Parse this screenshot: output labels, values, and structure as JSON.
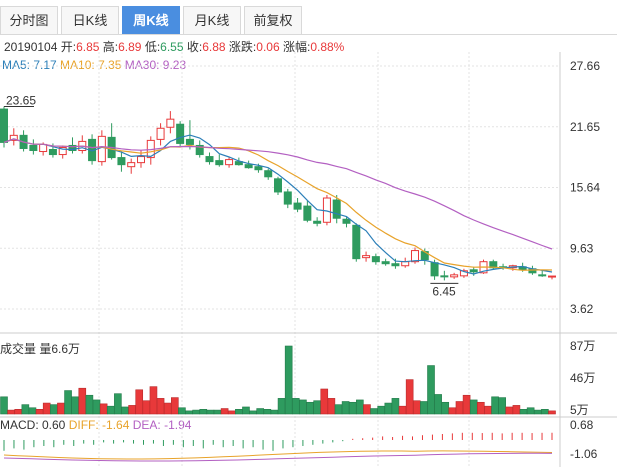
{
  "tabs": [
    {
      "label": "分时图",
      "active": false
    },
    {
      "label": "日K线",
      "active": false
    },
    {
      "label": "周K线",
      "active": true
    },
    {
      "label": "月K线",
      "active": false
    },
    {
      "label": "前复权",
      "active": false
    }
  ],
  "info": {
    "date": "20190104",
    "open_label": "开:",
    "open": "6.85",
    "high_label": "高:",
    "high": "6.89",
    "low_label": "低:",
    "low": "6.55",
    "close_label": "收:",
    "close": "6.88",
    "change_label": "涨跌:",
    "change": "0.06",
    "pct_label": "涨幅:",
    "pct": "0.88%"
  },
  "ma_legend": {
    "ma5": "MA5: 7.17",
    "ma10": "MA10: 7.35",
    "ma30": "MA30: 9.23"
  },
  "volume_legend": {
    "label": "成交量 量6.6万"
  },
  "macd_legend": {
    "macd": "MACD: 0.60",
    "diff": "DIFF: -1.64",
    "dea": "DEA: -1.94"
  },
  "colors": {
    "up": "#e8393a",
    "down": "#2e9b5f",
    "ma5": "#2c7fb8",
    "ma10": "#e8a32b",
    "ma30": "#b360c2",
    "grid": "#e3e3e3"
  },
  "chart_data": {
    "type": "candlestick",
    "price_axis": {
      "ticks": [
        "27.66",
        "21.65",
        "15.64",
        "9.63",
        "3.62"
      ],
      "ylim": [
        3.62,
        27.66
      ]
    },
    "annotations": {
      "max": "23.65",
      "min": "6.45"
    },
    "candles": [
      [
        23.4,
        23.65,
        19.6,
        20.1
      ],
      [
        20.3,
        21.5,
        19.8,
        20.8
      ],
      [
        20.8,
        21.3,
        19.2,
        19.5
      ],
      [
        19.8,
        20.4,
        18.9,
        19.3
      ],
      [
        19.2,
        20.1,
        18.8,
        19.9
      ],
      [
        19.4,
        20.0,
        18.6,
        18.9
      ],
      [
        18.9,
        19.8,
        18.5,
        19.6
      ],
      [
        19.8,
        20.6,
        19.0,
        19.3
      ],
      [
        19.3,
        20.8,
        19.0,
        20.2
      ],
      [
        20.4,
        20.9,
        17.9,
        18.3
      ],
      [
        18.2,
        21.3,
        17.8,
        20.7
      ],
      [
        20.6,
        22.0,
        18.4,
        18.6
      ],
      [
        18.6,
        19.2,
        17.2,
        17.9
      ],
      [
        17.7,
        18.5,
        17.0,
        18.1
      ],
      [
        18.1,
        19.3,
        17.6,
        18.7
      ],
      [
        18.6,
        20.7,
        17.9,
        20.3
      ],
      [
        20.4,
        22.0,
        19.8,
        21.5
      ],
      [
        21.6,
        23.2,
        21.0,
        22.4
      ],
      [
        21.9,
        22.2,
        19.6,
        20.0
      ],
      [
        20.4,
        22.3,
        19.4,
        19.9
      ],
      [
        19.8,
        20.3,
        18.6,
        18.9
      ],
      [
        18.7,
        19.1,
        17.9,
        18.2
      ],
      [
        18.3,
        18.9,
        17.7,
        17.9
      ],
      [
        17.9,
        18.6,
        17.6,
        18.4
      ],
      [
        18.2,
        18.6,
        17.8,
        17.9
      ],
      [
        17.9,
        18.3,
        17.5,
        17.6
      ],
      [
        17.7,
        18.0,
        17.1,
        17.4
      ],
      [
        17.3,
        17.5,
        16.4,
        16.7
      ],
      [
        16.5,
        16.7,
        14.9,
        15.2
      ],
      [
        15.2,
        15.5,
        13.6,
        14.0
      ],
      [
        14.1,
        14.6,
        13.2,
        13.5
      ],
      [
        13.8,
        14.3,
        12.2,
        12.4
      ],
      [
        12.3,
        12.7,
        11.8,
        12.1
      ],
      [
        12.2,
        14.9,
        11.9,
        14.6
      ],
      [
        14.4,
        14.9,
        12.1,
        12.6
      ],
      [
        12.5,
        12.7,
        11.7,
        12.1
      ],
      [
        11.9,
        12.1,
        8.3,
        8.6
      ],
      [
        8.7,
        9.3,
        8.3,
        8.9
      ],
      [
        8.8,
        9.1,
        8.0,
        8.3
      ],
      [
        8.3,
        8.6,
        7.9,
        8.1
      ],
      [
        8.1,
        8.6,
        7.6,
        7.9
      ],
      [
        7.9,
        8.7,
        7.7,
        8.3
      ],
      [
        8.3,
        9.7,
        8.1,
        9.4
      ],
      [
        9.3,
        9.6,
        8.0,
        8.5
      ],
      [
        8.2,
        8.5,
        6.5,
        6.9
      ],
      [
        6.9,
        7.4,
        6.45,
        6.8
      ],
      [
        6.8,
        7.2,
        6.6,
        7.0
      ],
      [
        6.9,
        7.6,
        6.7,
        7.4
      ],
      [
        7.5,
        7.8,
        6.9,
        7.3
      ],
      [
        7.2,
        8.5,
        7.1,
        8.3
      ],
      [
        8.3,
        8.5,
        7.5,
        7.7
      ],
      [
        7.8,
        8.1,
        7.5,
        7.7
      ],
      [
        7.7,
        8.0,
        7.4,
        7.9
      ],
      [
        7.8,
        8.2,
        7.3,
        7.5
      ],
      [
        7.6,
        7.9,
        7.0,
        7.2
      ],
      [
        7.0,
        7.5,
        6.8,
        6.9
      ],
      [
        6.85,
        6.89,
        6.55,
        6.88
      ]
    ],
    "volume_axis": {
      "ticks": [
        "87万",
        "46万",
        "5万"
      ],
      "ylim": [
        0,
        87
      ]
    },
    "volume": [
      22,
      5,
      6,
      12,
      8,
      6,
      14,
      12,
      14,
      30,
      22,
      33,
      24,
      18,
      13,
      10,
      26,
      9,
      11,
      31,
      17,
      35,
      20,
      14,
      21,
      8,
      4,
      5,
      6,
      5,
      5,
      7,
      4,
      6,
      9,
      4,
      7,
      6,
      5,
      20,
      87,
      20,
      18,
      15,
      17,
      32,
      20,
      12,
      16,
      15,
      18,
      12,
      7,
      10,
      14,
      20,
      10,
      44,
      17,
      16,
      62,
      25,
      15,
      8,
      16,
      24,
      18,
      15,
      10,
      22,
      21,
      9,
      11,
      6,
      8,
      5,
      6,
      4
    ],
    "macd_axis": {
      "ticks": [
        "0.68",
        "-1.06"
      ]
    },
    "macd": [
      -0.9,
      -0.7,
      -0.8,
      -0.6,
      -0.5,
      -0.6,
      -0.4,
      -0.5,
      -0.3,
      -0.4,
      -0.2,
      -0.3,
      -0.2,
      -0.3,
      -0.4,
      -0.3,
      -0.5,
      -0.4,
      -0.6,
      -0.5,
      -0.7,
      -0.4,
      -0.6,
      -0.5,
      -0.7,
      -0.6,
      -0.8,
      -0.9,
      -0.7,
      -0.6,
      -0.5,
      -0.4,
      -0.3,
      -0.2,
      -0.1,
      0.1,
      0.15,
      0.2,
      0.3,
      0.25,
      0.35,
      0.3,
      0.4,
      0.45,
      0.5,
      0.55,
      0.6,
      0.6,
      0.58,
      0.6,
      0.55,
      0.6,
      0.6,
      0.58,
      0.6,
      0.6
    ]
  }
}
